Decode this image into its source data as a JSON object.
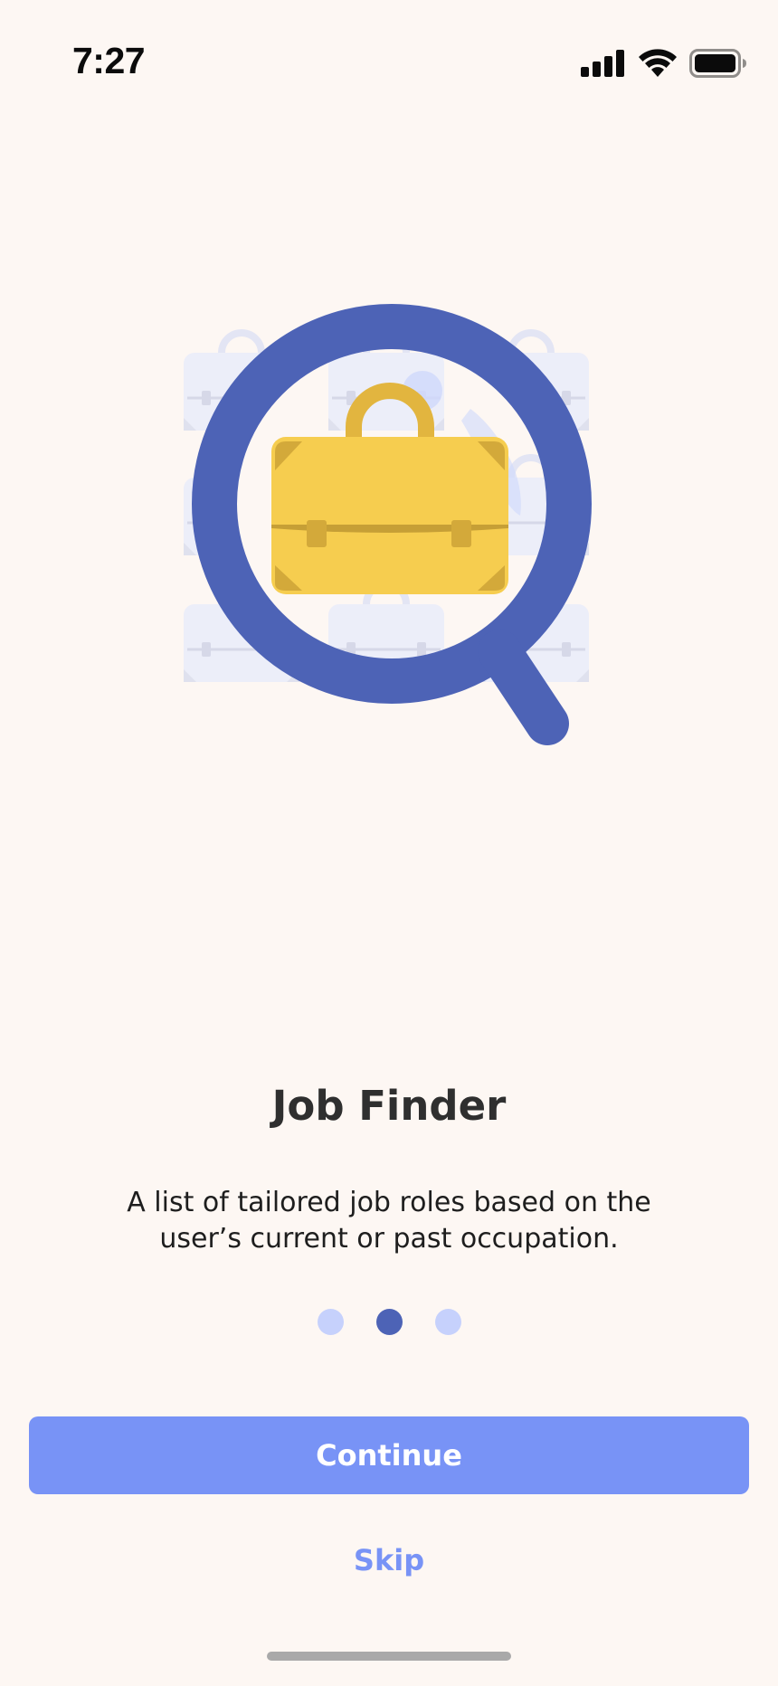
{
  "status_bar": {
    "time": "7:27",
    "icons": [
      "signal-icon",
      "wifi-icon",
      "battery-icon"
    ]
  },
  "illustration": {
    "icon": "magnifier-briefcase-icon",
    "colors": {
      "magnifier": "#4d63b6",
      "briefcase": "#f6cd4f",
      "briefcase_dark": "#d3a93a",
      "background_briefcases": "#eceef9"
    }
  },
  "onboarding": {
    "title": "Job Finder",
    "description": "A list of tailored job roles based on the user’s current or past occupation.",
    "page_indicator": {
      "total": 3,
      "current": 2
    }
  },
  "actions": {
    "continue_label": "Continue",
    "skip_label": "Skip"
  },
  "colors": {
    "background": "#fdf7f3",
    "accent": "#7893f6",
    "dot_active": "#4d63b6",
    "dot_inactive": "#c6d1fc"
  }
}
